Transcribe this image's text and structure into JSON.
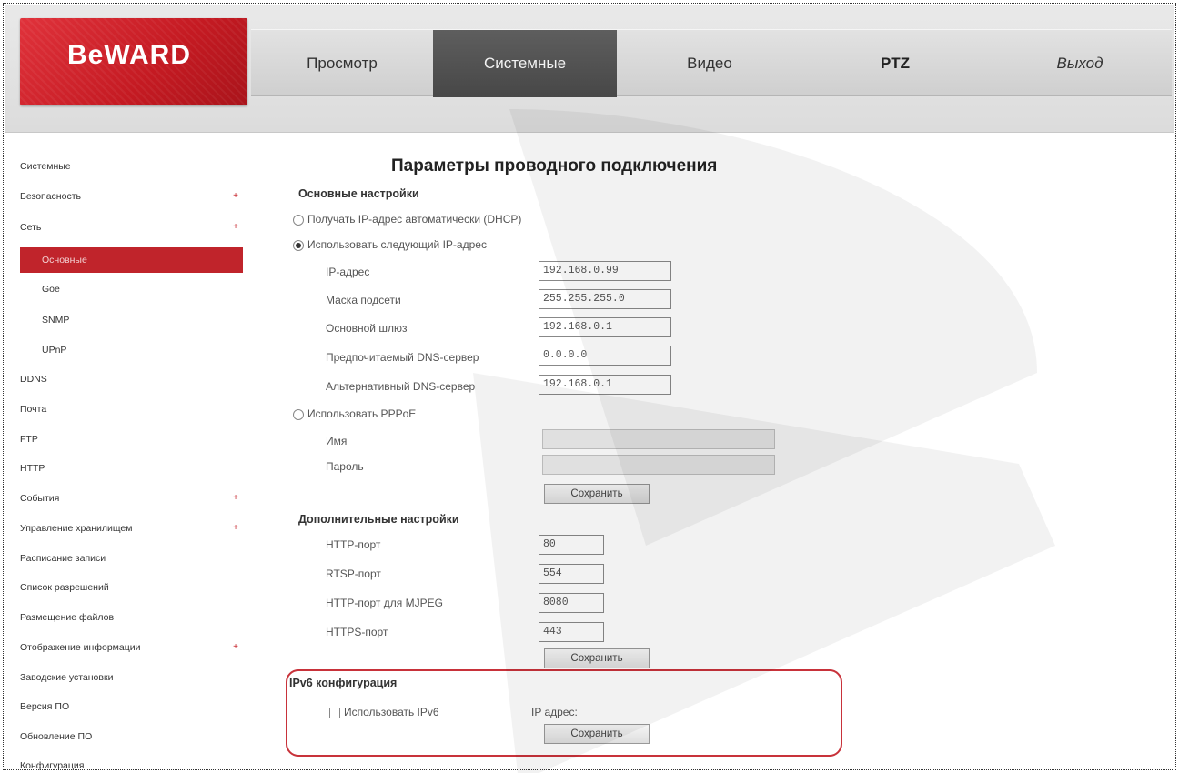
{
  "brand": {
    "name": "BeWARD",
    "tagline": ""
  },
  "nav": {
    "tabs": [
      {
        "label": "Просмотр",
        "active": false
      },
      {
        "label": "Системные",
        "active": true
      },
      {
        "label": "Видео",
        "active": false
      },
      {
        "label": "PTZ",
        "active": false
      },
      {
        "label": "Выход",
        "active": false
      }
    ]
  },
  "sidebar": {
    "items": [
      {
        "label": "Системные",
        "expand": ""
      },
      {
        "label": "Безопасность",
        "expand": "+"
      },
      {
        "label": "Сеть",
        "expand": "+"
      },
      {
        "label": "Основные",
        "expand": ""
      },
      {
        "label": "Goe",
        "expand": ""
      },
      {
        "label": "SNMP",
        "expand": ""
      },
      {
        "label": "UPnP",
        "expand": ""
      },
      {
        "label": "DDNS",
        "expand": ""
      },
      {
        "label": "Почта",
        "expand": ""
      },
      {
        "label": "FTP",
        "expand": ""
      },
      {
        "label": "HTTP",
        "expand": ""
      },
      {
        "label": "События",
        "expand": "+"
      },
      {
        "label": "Управление хранилищем",
        "expand": "+"
      },
      {
        "label": "Расписание записи",
        "expand": ""
      },
      {
        "label": "Список разрешений",
        "expand": ""
      },
      {
        "label": "Размещение файлов",
        "expand": ""
      },
      {
        "label": "Отображение информации",
        "expand": "+"
      },
      {
        "label": "Заводские установки",
        "expand": ""
      },
      {
        "label": "Версия ПО",
        "expand": ""
      },
      {
        "label": "Обновление ПО",
        "expand": ""
      },
      {
        "label": "Конфигурация",
        "expand": ""
      }
    ]
  },
  "page": {
    "title": "Параметры проводного подключения",
    "basic": {
      "title": "Основные настройки",
      "dhcp_label": "Получать IP-адрес автоматически (DHCP)",
      "static_label": "Использовать следующий IP-адрес",
      "fields": [
        {
          "label": "IP-адрес",
          "value": "192.168.0.99"
        },
        {
          "label": "Маска подсети",
          "value": "255.255.255.0"
        },
        {
          "label": "Основной шлюз",
          "value": "192.168.0.1"
        },
        {
          "label": "Предпочитаемый DNS-сервер",
          "value": "0.0.0.0"
        },
        {
          "label": "Альтернативный DNS-сервер",
          "value": "192.168.0.1"
        }
      ],
      "pppoe_label": "Использовать PPPoE",
      "pppoe_fields": [
        {
          "label": "Имя",
          "value": ""
        },
        {
          "label": "Пароль",
          "value": ""
        }
      ],
      "save_label": "Сохранить"
    },
    "extra": {
      "title": "Дополнительные настройки",
      "fields": [
        {
          "label": "HTTP-порт",
          "value": "80"
        },
        {
          "label": "RTSP-порт",
          "value": "554"
        },
        {
          "label": "HTTP-порт для MJPEG",
          "value": "8080"
        },
        {
          "label": "HTTPS-порт",
          "value": "443"
        }
      ],
      "save_label": "Сохранить"
    },
    "ipv6": {
      "title": "IPv6 конфигурация",
      "use_label": "Использовать IPv6",
      "ip_label": "IP адрес:",
      "save_label": "Сохранить"
    }
  },
  "colors": {
    "brand": "#c41a22",
    "active_tab": "#4f4f4f",
    "highlight": "#c8323a"
  }
}
